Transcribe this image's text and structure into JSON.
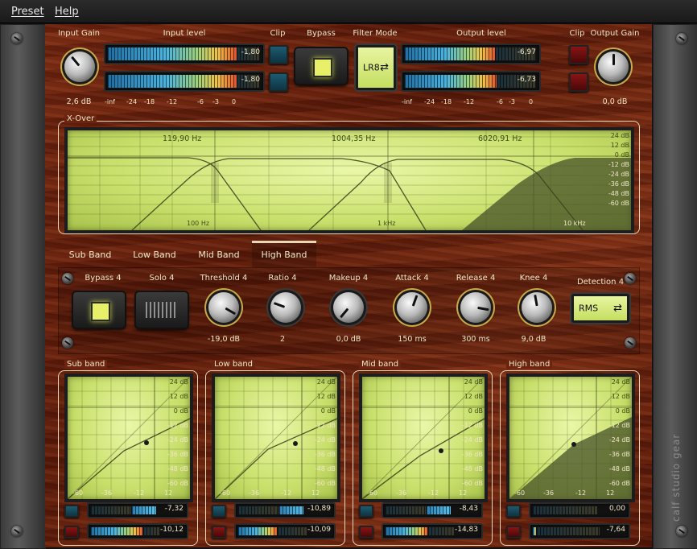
{
  "menu": {
    "preset": "Preset",
    "help": "Help"
  },
  "brand": {
    "logo": "calf studio gear"
  },
  "header": {
    "input_gain_label": "Input Gain",
    "input_gain_value": "2,6 dB",
    "input_level_label": "Input level",
    "input_l": "-1,80",
    "input_r": "-1,80",
    "clip_label_in": "Clip",
    "bypass_label": "Bypass",
    "filter_mode_label": "Filter Mode",
    "filter_mode_value": "LR8",
    "output_level_label": "Output level",
    "output_l": "-6,97",
    "output_r": "-6,73",
    "clip_label_out": "Clip",
    "output_gain_label": "Output Gain",
    "output_gain_value": "0,0 dB",
    "scale": [
      "-inf",
      "-24",
      "-18",
      "-12",
      "-6",
      "-3",
      "0"
    ]
  },
  "xover": {
    "title": "X-Over",
    "freqs": [
      "119,90 Hz",
      "1004,35 Hz",
      "6020,91 Hz"
    ],
    "db_ticks": [
      "24 dB",
      "12 dB",
      "0 dB",
      "-12 dB",
      "-24 dB",
      "-36 dB",
      "-48 dB",
      "-60 dB"
    ],
    "f_ticks": [
      "100 Hz",
      "1 kHz",
      "10 kHz"
    ]
  },
  "tabs": [
    "Sub Band",
    "Low Band",
    "Mid Band",
    "High Band"
  ],
  "controls": {
    "bypass": "Bypass 4",
    "solo": "Solo 4",
    "threshold_label": "Threshold 4",
    "threshold_value": "-19,0 dB",
    "ratio_label": "Ratio 4",
    "ratio_value": "2",
    "makeup_label": "Makeup 4",
    "makeup_value": "0,0 dB",
    "attack_label": "Attack 4",
    "attack_value": "150 ms",
    "release_label": "Release 4",
    "release_value": "300 ms",
    "knee_label": "Knee 4",
    "knee_value": "9,0 dB",
    "detection_label": "Detection 4",
    "detection_value": "RMS"
  },
  "bands": [
    {
      "title": "Sub band",
      "meter1": "-7,32",
      "meter2": "-10,12"
    },
    {
      "title": "Low band",
      "meter1": "-10,89",
      "meter2": "-10,09"
    },
    {
      "title": "Mid band",
      "meter1": "-8,43",
      "meter2": "-14,83"
    },
    {
      "title": "High band",
      "meter1": "0,00",
      "meter2": "-7,64"
    }
  ],
  "band_db_ticks": [
    "24 dB",
    "12 dB",
    "0 dB",
    "-12 dB",
    "-24 dB",
    "-36 dB",
    "-48 dB",
    "-60 dB"
  ],
  "band_x_ticks": [
    "-60",
    "-36",
    "-12",
    "12"
  ],
  "colors": {
    "wood": "#6a2410",
    "lcd": "#d6ec80",
    "text": "#f0e6c8"
  }
}
